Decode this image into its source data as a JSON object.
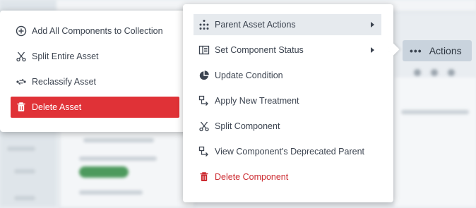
{
  "actions_button": {
    "label": "Actions"
  },
  "left_menu": {
    "items": [
      {
        "label": "Add All Components to Collection",
        "icon": "plus-circle-icon"
      },
      {
        "label": "Split Entire Asset",
        "icon": "scissors-icon"
      },
      {
        "label": "Reclassify Asset",
        "icon": "reclassify-icon"
      },
      {
        "label": "Delete Asset",
        "icon": "trash-icon",
        "style": "danger-filled"
      }
    ]
  },
  "right_menu": {
    "items": [
      {
        "label": "Parent Asset Actions",
        "icon": "hierarchy-icon",
        "has_submenu": true,
        "highlighted": true
      },
      {
        "label": "Set Component Status",
        "icon": "status-panel-icon",
        "has_submenu": true
      },
      {
        "label": "Update Condition",
        "icon": "pie-chart-icon"
      },
      {
        "label": "Apply New Treatment",
        "icon": "treatment-icon"
      },
      {
        "label": "Split Component",
        "icon": "scissors-icon"
      },
      {
        "label": "View Component's Deprecated Parent",
        "icon": "parent-link-icon"
      },
      {
        "label": "Delete Component",
        "icon": "trash-icon",
        "style": "danger-text"
      }
    ]
  },
  "colors": {
    "danger": "#e03237",
    "highlight": "#e6eaee",
    "actions_bg": "#c9d3dd"
  }
}
